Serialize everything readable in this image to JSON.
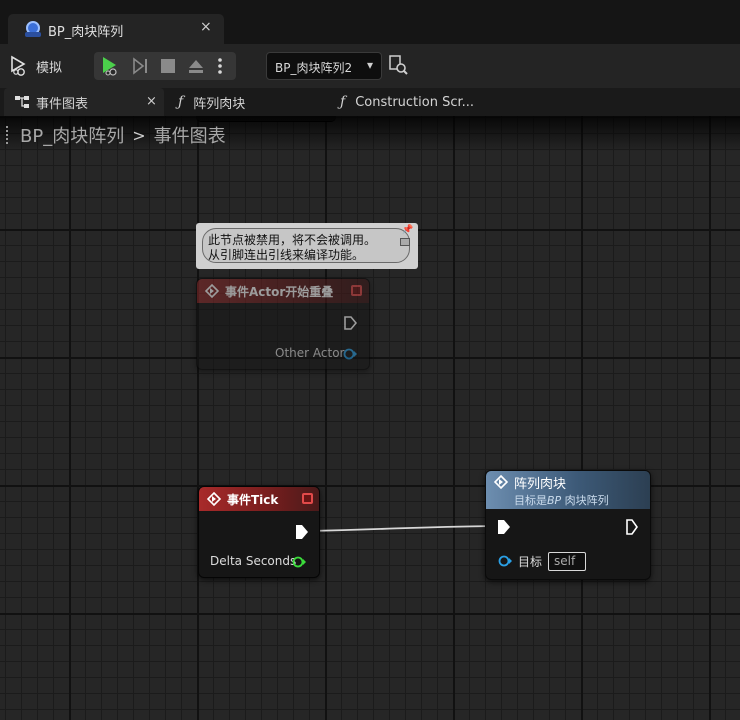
{
  "window": {
    "tab_title": "BP_肉块阵列",
    "tab_close": "×"
  },
  "toolbar": {
    "simulate_label": "模拟",
    "debug_object": "BP_肉块阵列2",
    "dropdown_chevron": "▾"
  },
  "graph_tabs": [
    {
      "label": "事件图表",
      "close": "×"
    },
    {
      "icon": "ƒ",
      "label": "阵列肉块"
    },
    {
      "icon": "ƒ",
      "label": "Construction Scr..."
    }
  ],
  "breadcrumb": {
    "blueprint": "BP_肉块阵列",
    "separator": ">",
    "graph": "事件图表"
  },
  "disabled_comment": {
    "line1": "此节点被禁用，将不会被调用。",
    "line2": "从引脚连出引线来编译功能。"
  },
  "nodes": {
    "overlap": {
      "title": "事件Actor开始重叠",
      "pin_other_actor": "Other Actor"
    },
    "tick": {
      "title": "事件Tick",
      "pin_delta_seconds": "Delta Seconds"
    },
    "array": {
      "title": "阵列肉块",
      "subtitle_prefix": "目标是",
      "subtitle_italic": "BP",
      "subtitle_suffix": " 肉块阵列",
      "pin_target": "目标",
      "target_default": "self"
    }
  },
  "colors": {
    "event_header": "#a82a2a",
    "function_header": "#6d8eb0",
    "exec_pin": "#ffffff",
    "object_pin": "#2aa0e6",
    "float_pin": "#3bdc3b",
    "play_green": "#4bd04b"
  }
}
